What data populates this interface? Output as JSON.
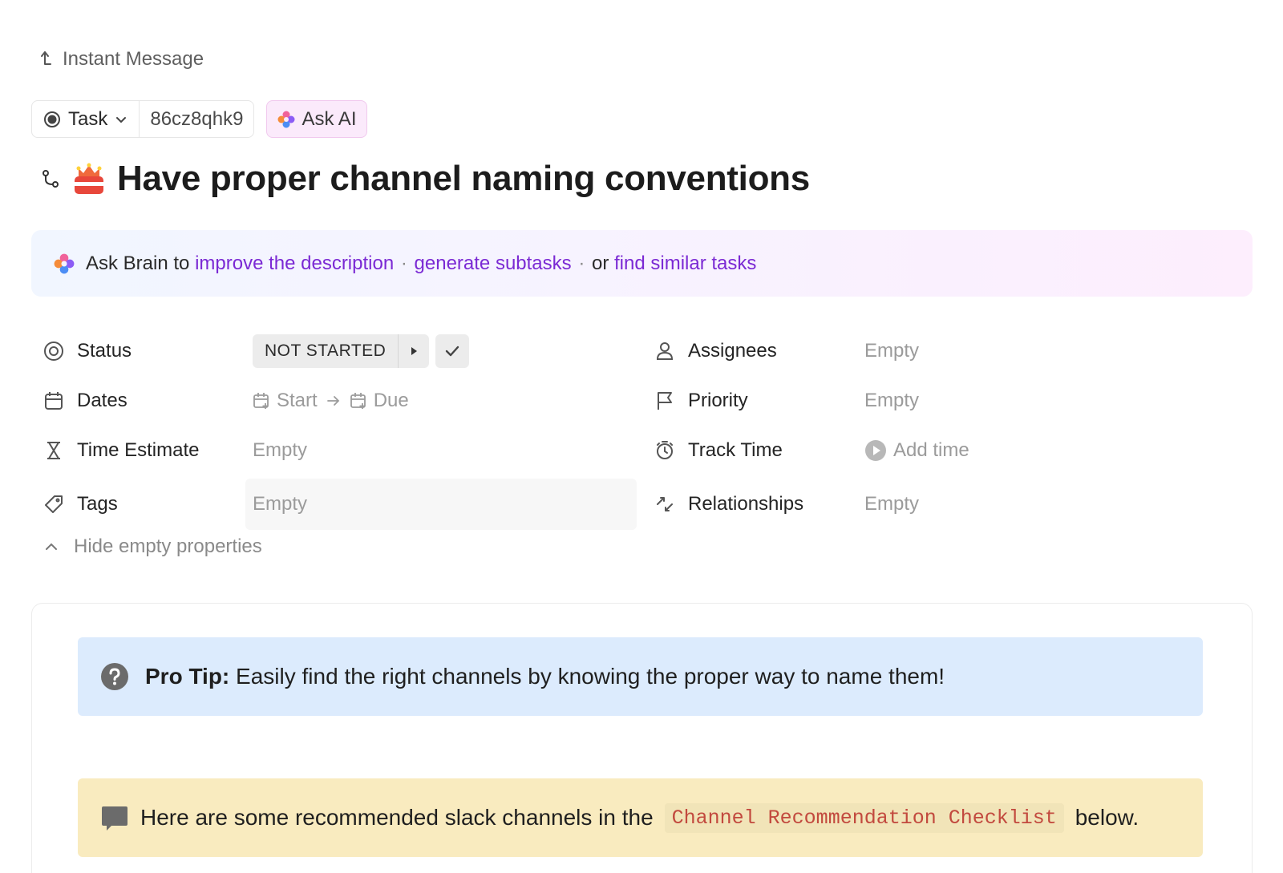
{
  "breadcrumb": {
    "label": "Instant Message"
  },
  "task_meta": {
    "type_label": "Task",
    "task_id": "86cz8qhk9",
    "ask_ai_label": "Ask AI"
  },
  "task": {
    "title": "Have proper channel naming conventions"
  },
  "brain": {
    "prefix": "Ask Brain to",
    "link_improve": "improve the description",
    "sep1": "·",
    "link_subtasks": "generate subtasks",
    "sep2": "·",
    "or": "or",
    "link_similar": "find similar tasks"
  },
  "properties": {
    "status": {
      "label": "Status",
      "value": "NOT STARTED"
    },
    "dates": {
      "label": "Dates",
      "start": "Start",
      "due": "Due"
    },
    "time_estimate": {
      "label": "Time Estimate",
      "value": "Empty"
    },
    "tags": {
      "label": "Tags",
      "value": "Empty"
    },
    "assignees": {
      "label": "Assignees",
      "value": "Empty"
    },
    "priority": {
      "label": "Priority",
      "value": "Empty"
    },
    "track_time": {
      "label": "Track Time",
      "value": "Add time"
    },
    "relationships": {
      "label": "Relationships",
      "value": "Empty"
    },
    "hide_empty_label": "Hide empty properties"
  },
  "description": {
    "pro_tip_bold": "Pro Tip:",
    "pro_tip_text": "Easily find the right channels by knowing the proper way to name them!",
    "callout_before": "Here are some recommended slack channels in the",
    "callout_code": "Channel Recommendation Checklist",
    "callout_after": "below."
  },
  "colors": {
    "link_purple": "#7b2ad4",
    "pro_tip_bg": "#dcebfd",
    "callout_bg": "#f9ebbf",
    "code_red": "#c2493e"
  }
}
